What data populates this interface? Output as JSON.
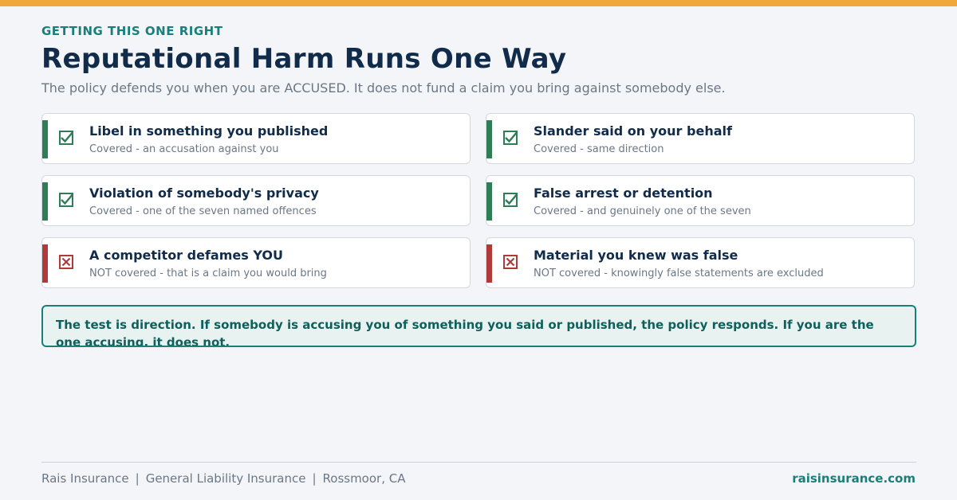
{
  "header": {
    "eyebrow": "GETTING THIS ONE RIGHT",
    "title": "Reputational Harm Runs One Way",
    "subtitle": "The policy defends you when you are ACCUSED. It does not fund a claim you bring against somebody else."
  },
  "cards": [
    {
      "title": "Libel in something you published",
      "desc": "Covered - an accusation against you",
      "covered": true,
      "icon": "check-icon"
    },
    {
      "title": "Slander said on your behalf",
      "desc": "Covered - same direction",
      "covered": true,
      "icon": "check-icon"
    },
    {
      "title": "Violation of somebody's privacy",
      "desc": "Covered - one of the seven named offences",
      "covered": true,
      "icon": "check-icon"
    },
    {
      "title": "False arrest or detention",
      "desc": "Covered - and genuinely one of the seven",
      "covered": true,
      "icon": "check-icon"
    },
    {
      "title": "A competitor defames YOU",
      "desc": "NOT covered - that is a claim you would bring",
      "covered": false,
      "icon": "x-icon"
    },
    {
      "title": "Material you knew was false",
      "desc": "NOT covered - knowingly false statements are excluded",
      "covered": false,
      "icon": "x-icon"
    }
  ],
  "callout": "The test is direction. If somebody is accusing you of something you said or published, the policy responds. If you are the one accusing, it does not.",
  "footer": {
    "company": "Rais Insurance",
    "line": "General Liability Insurance",
    "location": "Rossmoor, CA",
    "website": "raisinsurance.com"
  },
  "colors": {
    "accent_bar": "#f0a83c",
    "teal": "#1a7f7a",
    "navy": "#112b4a",
    "covered": "#2e7d57",
    "not_covered": "#b03a3a"
  }
}
